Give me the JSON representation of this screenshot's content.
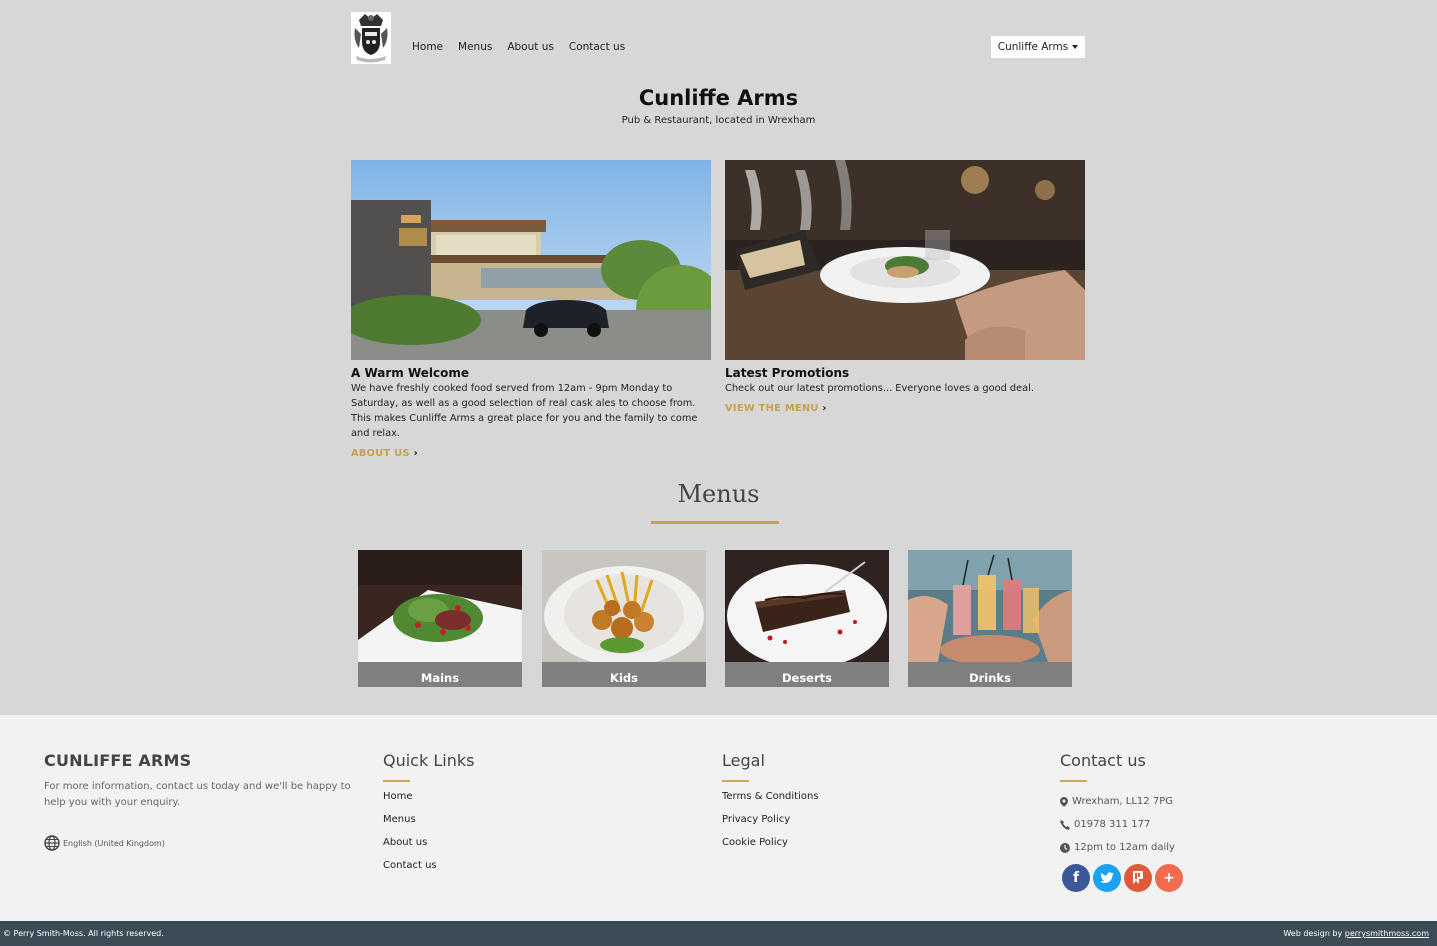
{
  "header": {
    "logo_icon": "coat-of-arms-logo",
    "nav": [
      "Home",
      "Menus",
      "About us",
      "Contact us"
    ],
    "location_label": "Cunliffe Arms"
  },
  "hero": {
    "title": "Cunliffe Arms",
    "subtitle": "Pub & Restaurant, located in Wrexham"
  },
  "features": [
    {
      "title": "A Warm Welcome",
      "text": "We have freshly cooked food served from 12am - 9pm Monday to Saturday, as well as a good selection of real cask ales to choose from. This makes Cunliffe Arms a great place for you and the family to come and relax.",
      "cta": "ABOUT US",
      "image": "pub-building-photo"
    },
    {
      "title": "Latest Promotions",
      "text": "Check out our latest promotions... Everyone loves a good deal.",
      "cta": "VIEW THE MENU",
      "image": "restaurant-dining-photo"
    }
  ],
  "menus": {
    "title": "Menus",
    "items": [
      {
        "label": "Mains",
        "image": "salad-dish-photo"
      },
      {
        "label": "Kids",
        "image": "nuggets-fries-photo"
      },
      {
        "label": "Deserts",
        "image": "chocolate-cake-photo"
      },
      {
        "label": "Drinks",
        "image": "cocktails-photo"
      }
    ]
  },
  "footer": {
    "brand": "CUNLIFFE ARMS",
    "description": "For more information, contact us today and we'll be happy to help you with your enquiry.",
    "language": "English (United Kingdom)",
    "quick_links": {
      "title": "Quick Links",
      "items": [
        "Home",
        "Menus",
        "About us",
        "Contact us"
      ]
    },
    "legal": {
      "title": "Legal",
      "items": [
        "Terms & Conditions",
        "Privacy Policy",
        "Cookie Policy"
      ]
    },
    "contact": {
      "title": "Contact us",
      "address": "Wrexham, LL12 7PG",
      "phone": "01978 311 177",
      "hours": "12pm to 12am daily",
      "socials": [
        "facebook-icon",
        "twitter-icon",
        "foursquare-icon",
        "add-icon"
      ]
    }
  },
  "bottom_bar": {
    "copyright": "© Perry Smith-Moss. All rights reserved.",
    "credit_prefix": "Web design by ",
    "credit_link": "perrysmithmoss.com"
  },
  "colors": {
    "accent": "#c4a14a",
    "page_bg": "#d7d7d7",
    "footer_bg": "#f2f2f2",
    "bottom_bar": "#3c4c57",
    "facebook": "#3b5998",
    "twitter": "#1da1f2",
    "foursquare": "#e05a3a",
    "add": "#f06b50"
  }
}
